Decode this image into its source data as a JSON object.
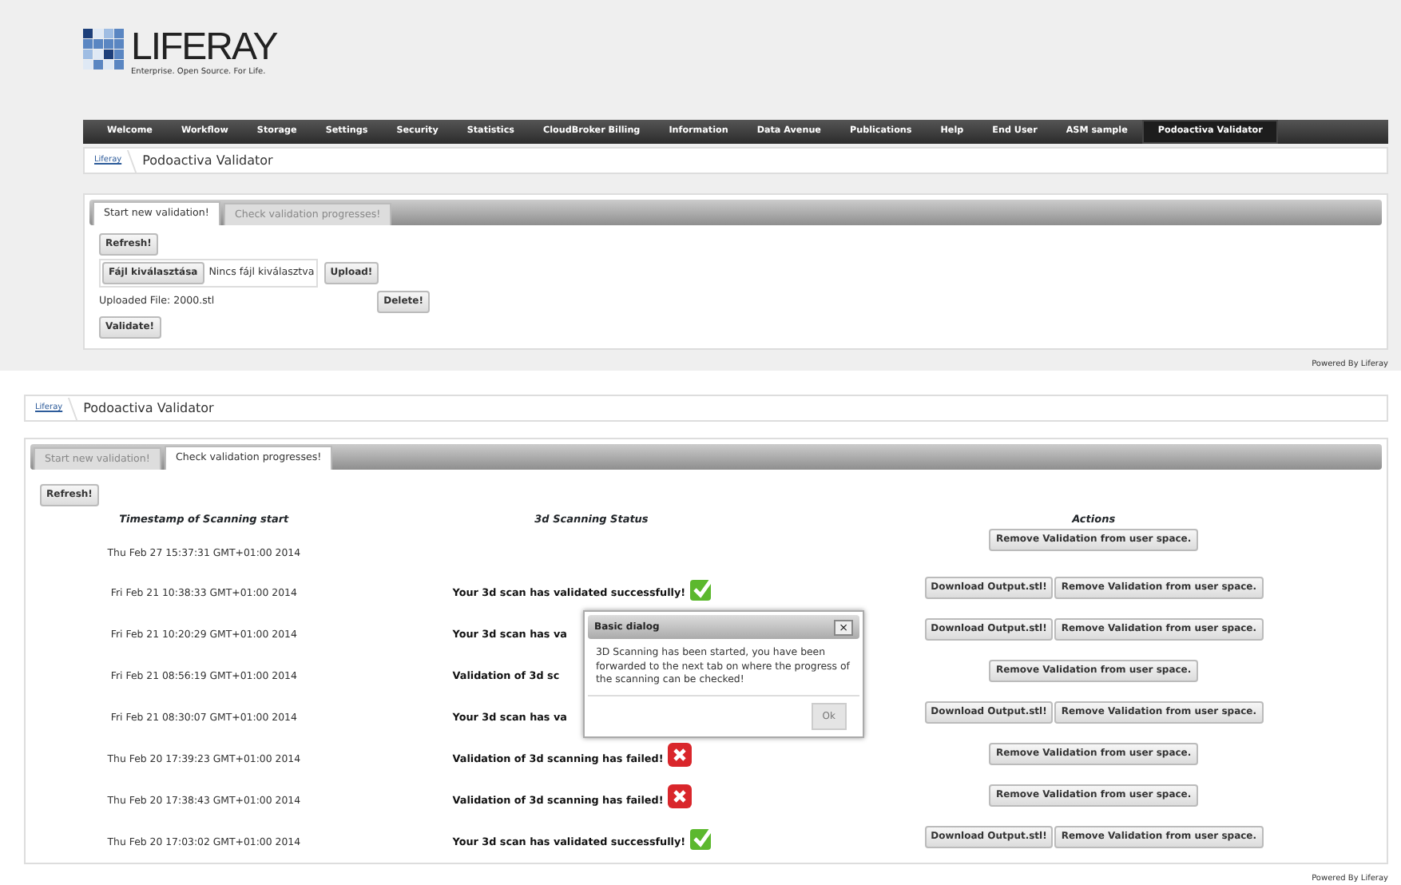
{
  "top": {
    "logo": {
      "title": "LIFERAY",
      "tagline": "Enterprise. Open Source. For Life."
    },
    "nav": [
      {
        "label": "Welcome",
        "selected": false
      },
      {
        "label": "Workflow",
        "selected": false
      },
      {
        "label": "Storage",
        "selected": false
      },
      {
        "label": "Settings",
        "selected": false
      },
      {
        "label": "Security",
        "selected": false
      },
      {
        "label": "Statistics",
        "selected": false
      },
      {
        "label": "CloudBroker Billing",
        "selected": false
      },
      {
        "label": "Information",
        "selected": false
      },
      {
        "label": "Data Avenue",
        "selected": false
      },
      {
        "label": "Publications",
        "selected": false
      },
      {
        "label": "Help",
        "selected": false
      },
      {
        "label": "End User",
        "selected": false
      },
      {
        "label": "ASM sample",
        "selected": false
      },
      {
        "label": "Podoactiva Validator",
        "selected": true
      }
    ],
    "breadcrumb": [
      "Liferay",
      "Podoactiva Validator"
    ],
    "tabs": [
      {
        "label": "Start new validation!",
        "selected": true
      },
      {
        "label": "Check validation progresses!",
        "selected": false
      }
    ],
    "form": {
      "refresh": "Refresh!",
      "file_button": "Fájl kiválasztása",
      "file_status": "Nincs fájl kiválasztva",
      "upload": "Upload!",
      "uploaded": "Uploaded File: 2000.stl",
      "delete": "Delete!",
      "validate": "Validate!"
    },
    "footer": {
      "text": "Powered By",
      "link": "Liferay"
    }
  },
  "bottom": {
    "breadcrumb": [
      "Liferay",
      "Podoactiva Validator"
    ],
    "tabs": [
      {
        "label": "Start new validation!",
        "selected": false
      },
      {
        "label": "Check validation progresses!",
        "selected": true
      }
    ],
    "refresh": "Refresh!",
    "table": {
      "columns": [
        "Timestamp of Scanning start",
        "3d Scanning Status",
        "Actions"
      ],
      "rows": [
        {
          "timestamp": "Thu Feb 27 15:37:31 GMT+01:00 2014",
          "actions": [
            "Remove Validation from user space."
          ]
        },
        {
          "timestamp": "Fri Feb 21 10:38:33 GMT+01:00 2014",
          "status": "Your 3d scan has validated successfully!",
          "passed": true,
          "actions": [
            "Download Output.stl!",
            "Remove Validation from user space."
          ]
        },
        {
          "timestamp": "Fri Feb 21 10:20:29 GMT+01:00 2014",
          "status": "Your 3d scan has va",
          "actions": [
            "Download Output.stl!",
            "Remove Validation from user space."
          ]
        },
        {
          "timestamp": "Fri Feb 21 08:56:19 GMT+01:00 2014",
          "status": "Validation of 3d sc",
          "actions": [
            "Remove Validation from user space."
          ]
        },
        {
          "timestamp": "Fri Feb 21 08:30:07 GMT+01:00 2014",
          "status": "Your 3d scan has va",
          "actions": [
            "Download Output.stl!",
            "Remove Validation from user space."
          ]
        },
        {
          "timestamp": "Thu Feb 20 17:39:23 GMT+01:00 2014",
          "status": "Validation of 3d scanning has failed!",
          "passed": false,
          "actions": [
            "Remove Validation from user space."
          ]
        },
        {
          "timestamp": "Thu Feb 20 17:38:43 GMT+01:00 2014",
          "status": "Validation of 3d scanning has failed!",
          "passed": false,
          "actions": [
            "Remove Validation from user space."
          ]
        },
        {
          "timestamp": "Thu Feb 20 17:03:02 GMT+01:00 2014",
          "status": "Your 3d scan has validated successfully!",
          "passed": true,
          "actions": [
            "Download Output.stl!",
            "Remove Validation from user space."
          ]
        }
      ]
    },
    "dialog": {
      "title": "Basic dialog",
      "close": "×",
      "message": "3D Scanning has been started, you have been forwarded to the next tab on where the progress of the scanning can be checked!",
      "button": "Ok"
    },
    "footer": {
      "text": "Powered By",
      "link": "Liferay"
    }
  }
}
